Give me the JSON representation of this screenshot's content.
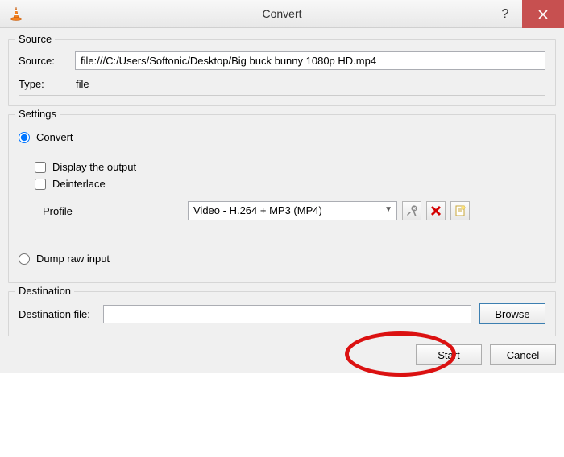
{
  "window": {
    "title": "Convert"
  },
  "source": {
    "legend": "Source",
    "source_label": "Source:",
    "source_value": "file:///C:/Users/Softonic/Desktop/Big buck bunny 1080p HD.mp4",
    "type_label": "Type:",
    "type_value": "file"
  },
  "settings": {
    "legend": "Settings",
    "convert_label": "Convert",
    "display_output_label": "Display the output",
    "deinterlace_label": "Deinterlace",
    "profile_label": "Profile",
    "profile_value": "Video - H.264 + MP3 (MP4)",
    "dump_label": "Dump raw input"
  },
  "destination": {
    "legend": "Destination",
    "dest_file_label": "Destination file:",
    "dest_file_value": "",
    "browse_label": "Browse"
  },
  "footer": {
    "start_label": "Start",
    "cancel_label": "Cancel"
  }
}
